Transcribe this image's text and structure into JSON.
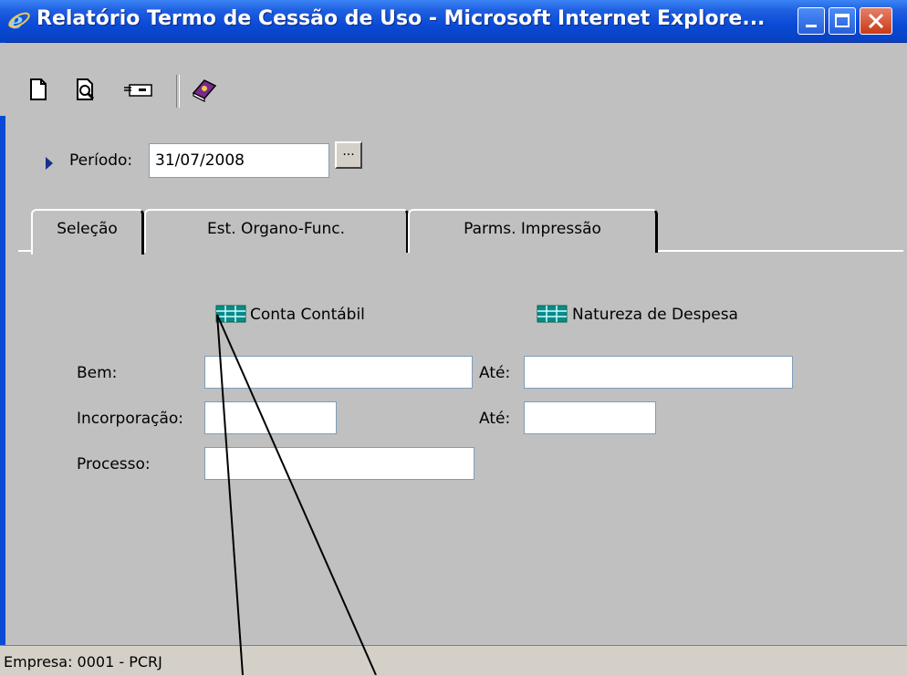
{
  "window": {
    "title": "Relatório Termo de Cessão de Uso - Microsoft Internet Explore..."
  },
  "toolbar": {
    "icons": [
      "new-document-icon",
      "print-preview-icon",
      "export-icon",
      "help-book-icon"
    ]
  },
  "period": {
    "label": "Período:",
    "value": "31/07/2008",
    "picker_label": "..."
  },
  "tabs": [
    {
      "label": "Seleção",
      "selected": true
    },
    {
      "label": "Est. Organo-Func.",
      "selected": false
    },
    {
      "label": "Parms. Impressão",
      "selected": false
    }
  ],
  "selection": {
    "conta_contabil_label": "Conta Contábil",
    "natureza_despesa_label": "Natureza de Despesa",
    "bem_label": "Bem:",
    "bem_ate_label": "Até:",
    "incorporacao_label": "Incorporação:",
    "incorporacao_ate_label": "Até:",
    "processo_label": "Processo:"
  },
  "status": {
    "text": "Empresa: 0001 - PCRJ"
  },
  "colors": {
    "titlebar": "#0a4ad6",
    "window_bg": "#c0c0c0",
    "grid_icon": "#0b8a8a"
  }
}
